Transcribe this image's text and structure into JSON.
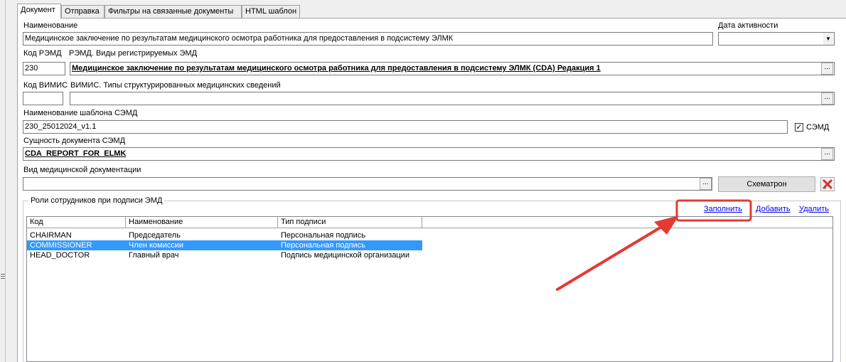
{
  "tabs": [
    {
      "label": "Документ",
      "active": true
    },
    {
      "label": "Отправка",
      "active": false
    },
    {
      "label": "Фильтры на связанные документы",
      "active": false
    },
    {
      "label": "HTML шаблон",
      "active": false
    }
  ],
  "form": {
    "name_label": "Наименование",
    "name_value": "Медицинское заключение по результатам медицинского осмотра работника для предоставления в подсистему ЭЛМК",
    "activity_date_label": "Дата активности",
    "activity_date_value": "",
    "remd_code_label": "Код РЭМД",
    "remd_code_value": "230",
    "remd_types_label": "РЭМД. Виды регистрируемых ЭМД",
    "remd_types_value": "Медицинское заключение по результатам медицинского осмотра работника для предоставления в подсистему ЭЛМК (CDA) Редакция 1",
    "vimis_code_label": "Код ВИМИС",
    "vimis_code_value": "",
    "vimis_types_label": "ВИМИС. Типы структурированных медицинских сведений",
    "vimis_types_value": "",
    "semd_template_label": "Наименование шаблона СЭМД",
    "semd_template_value": "230_25012024_v1.1",
    "semd_checkbox_label": "СЭМД",
    "semd_checked": true,
    "semd_entity_label": "Сущность документа СЭМД",
    "semd_entity_value": "CDA_REPORT_FOR_ELMK",
    "med_doc_type_label": "Вид медицинской документации",
    "med_doc_type_value": "",
    "browse_label": "...",
    "schematron_label": "Схематрон"
  },
  "roles": {
    "group_title": "Роли сотрудников при подписи ЭМД",
    "fill_link": "Заполнить",
    "add_link": "Добавить",
    "delete_link": "Удалить",
    "columns": [
      "Код",
      "Наименование",
      "Тип подписи"
    ],
    "rows": [
      {
        "code": "CHAIRMAN",
        "name": "Председатель",
        "sign_type": "Персональная подпись",
        "selected": false
      },
      {
        "code": "COMMISSIONER",
        "name": "Член комиссии",
        "sign_type": "Персональная подпись",
        "selected": true
      },
      {
        "code": "HEAD_DOCTOR",
        "name": "Главный врач",
        "sign_type": "Подпись медицинской организации",
        "selected": false
      }
    ]
  },
  "annotation": {
    "color": "#e53935"
  }
}
